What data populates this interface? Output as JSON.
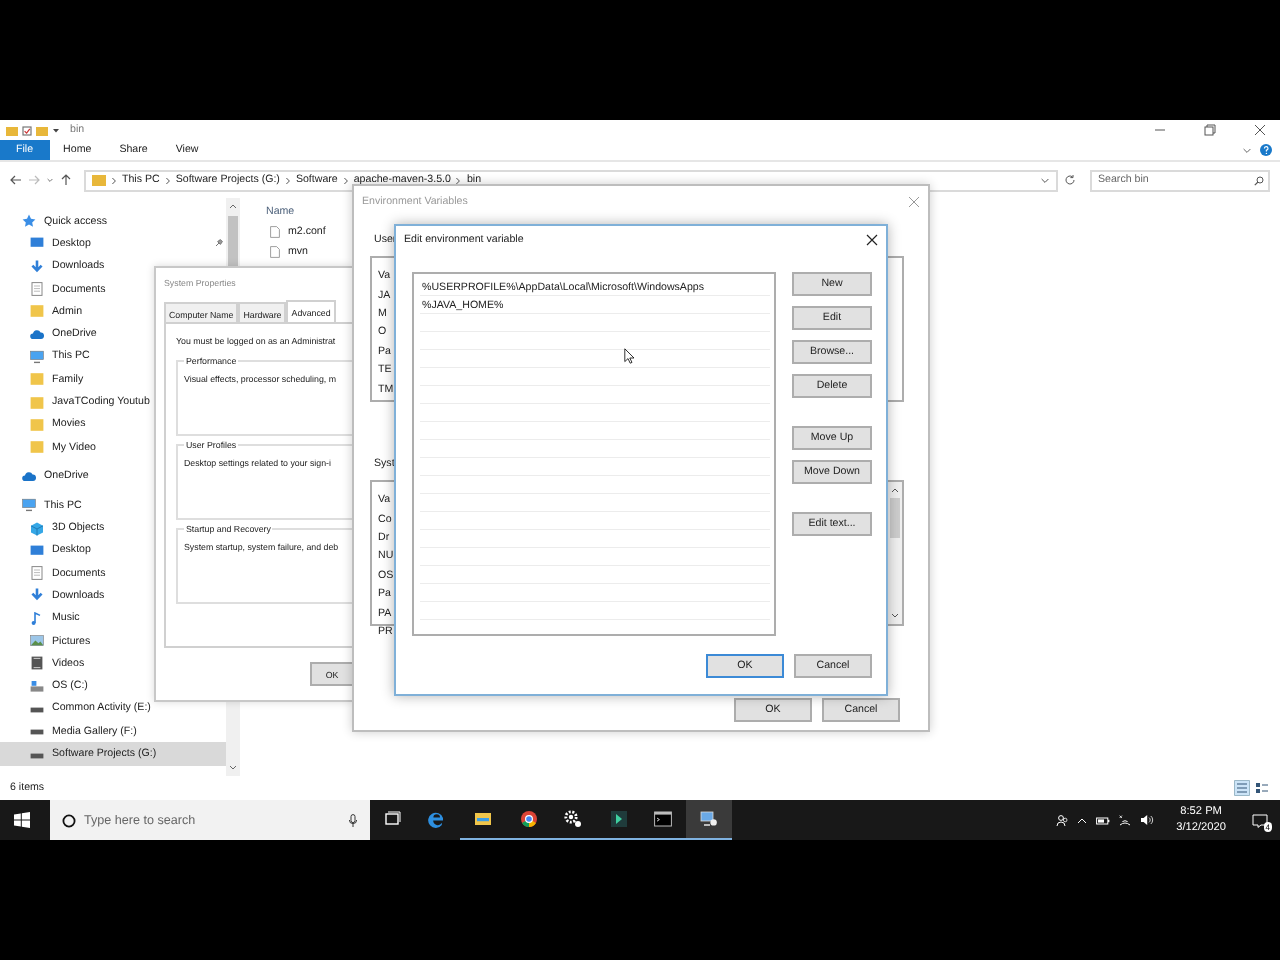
{
  "explorer": {
    "title": "bin",
    "ribbon_tabs": [
      {
        "label": "File",
        "selected": true
      },
      {
        "label": "Home",
        "selected": false
      },
      {
        "label": "Share",
        "selected": false
      },
      {
        "label": "View",
        "selected": false
      }
    ],
    "breadcrumbs": [
      "This PC",
      "Software Projects (G:)",
      "Software",
      "apache-maven-3.5.0",
      "bin"
    ],
    "search": {
      "placeholder": "Search bin"
    },
    "nav": [
      {
        "label": "Quick access",
        "kind": "star",
        "selected": false,
        "children": [
          {
            "label": "Desktop",
            "kind": "desktop",
            "selected": false,
            "pinned": true
          },
          {
            "label": "Downloads",
            "kind": "download",
            "selected": false,
            "pinned": false
          },
          {
            "label": "Documents",
            "kind": "document",
            "selected": false,
            "pinned": false
          },
          {
            "label": "Admin",
            "kind": "folder",
            "selected": false,
            "pinned": false
          },
          {
            "label": "OneDrive",
            "kind": "cloud",
            "selected": false,
            "pinned": false
          },
          {
            "label": "This PC",
            "kind": "pc",
            "selected": false,
            "pinned": false
          },
          {
            "label": "Family",
            "kind": "folder",
            "selected": false,
            "pinned": false
          },
          {
            "label": "JavaTCoding Youtub",
            "kind": "folder",
            "selected": false,
            "pinned": false
          },
          {
            "label": "Movies",
            "kind": "folder",
            "selected": false,
            "pinned": false
          },
          {
            "label": "My Video",
            "kind": "folder",
            "selected": false,
            "pinned": false
          }
        ]
      },
      {
        "label": "OneDrive",
        "kind": "cloud",
        "selected": false
      },
      {
        "label": "This PC",
        "kind": "pc",
        "selected": false,
        "children": [
          {
            "label": "3D Objects",
            "kind": "cube",
            "selected": false
          },
          {
            "label": "Desktop",
            "kind": "desktop",
            "selected": false
          },
          {
            "label": "Documents",
            "kind": "document",
            "selected": false
          },
          {
            "label": "Downloads",
            "kind": "download",
            "selected": false
          },
          {
            "label": "Music",
            "kind": "music",
            "selected": false
          },
          {
            "label": "Pictures",
            "kind": "picture",
            "selected": false
          },
          {
            "label": "Videos",
            "kind": "video",
            "selected": false
          },
          {
            "label": "OS (C:)",
            "kind": "osdrive",
            "selected": false
          },
          {
            "label": "Common Activity (E:)",
            "kind": "drive",
            "selected": false
          },
          {
            "label": "Media Gallery (F:)",
            "kind": "drive",
            "selected": false
          },
          {
            "label": "Software Projects (G:)",
            "kind": "drive",
            "selected": true
          }
        ]
      }
    ],
    "column_header": "Name",
    "files": [
      "m2.conf",
      "mvn"
    ],
    "status": "6 items"
  },
  "system_properties": {
    "title": "System Properties",
    "tabs": [
      {
        "label": "Computer Name",
        "selected": false
      },
      {
        "label": "Hardware",
        "selected": false
      },
      {
        "label": "Advanced",
        "selected": true
      }
    ],
    "notice": "You must be logged on as an Administrat",
    "groups": [
      {
        "title": "Performance",
        "text": "Visual effects, processor scheduling, m"
      },
      {
        "title": "User Profiles",
        "text": "Desktop settings related to your sign-i"
      },
      {
        "title": "Startup and Recovery",
        "text": "System startup, system failure, and deb"
      }
    ],
    "buttons": [
      "OK"
    ]
  },
  "environment_variables": {
    "title": "Environment Variables",
    "user_label": "User",
    "user_list": [
      "Va",
      "JA",
      "M",
      "O",
      "Pa",
      "TE",
      "TM"
    ],
    "system_label": "Syst",
    "system_list": [
      "Va",
      "Co",
      "Dr",
      "NU",
      "OS",
      "Pa",
      "PA",
      "PR"
    ],
    "buttons": [
      "OK",
      "Cancel"
    ]
  },
  "edit_dialog": {
    "title": "Edit environment variable",
    "entries": [
      "%USERPROFILE%\\AppData\\Local\\Microsoft\\WindowsApps",
      "%JAVA_HOME%"
    ],
    "side_buttons": [
      "New",
      "Edit",
      "Browse...",
      "Delete",
      "Move Up",
      "Move Down",
      "Edit text..."
    ],
    "buttons": [
      {
        "label": "OK",
        "kind": "default"
      },
      {
        "label": "Cancel",
        "kind": "normal"
      }
    ]
  },
  "taskbar": {
    "search": {
      "placeholder": "Type here to search"
    },
    "apps": [
      {
        "kind": "taskview",
        "running": false,
        "selected": false
      },
      {
        "kind": "edge",
        "running": false,
        "selected": false
      },
      {
        "kind": "explorer",
        "running": true,
        "selected": false
      },
      {
        "kind": "chrome",
        "running": true,
        "selected": false
      },
      {
        "kind": "gears",
        "running": true,
        "selected": false
      },
      {
        "kind": "app",
        "running": true,
        "selected": false
      },
      {
        "kind": "terminal",
        "running": true,
        "selected": false
      },
      {
        "kind": "sysprops",
        "running": true,
        "selected": true
      }
    ],
    "time": "8:52 PM",
    "date": "3/12/2020",
    "notifications": "4"
  }
}
